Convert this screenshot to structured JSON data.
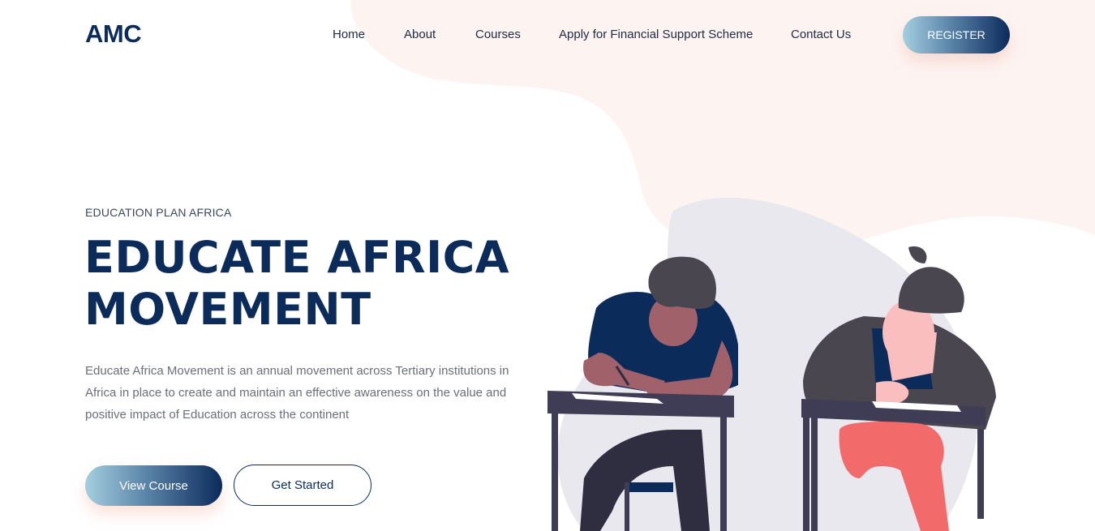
{
  "brand": {
    "logo": "AMC"
  },
  "nav": {
    "items": [
      "Home",
      "About",
      "Courses",
      "Apply for Financial Support Scheme",
      "Contact Us"
    ],
    "register_label": "REGISTER"
  },
  "hero": {
    "eyebrow": "EDUCATION PLAN AFRICA",
    "title_line1": "EDUCATE AFRICA",
    "title_line2": "MOVEMENT",
    "description": "Educate Africa Movement is an annual movement across Tertiary institutions in Africa in place to create and maintain an effective awareness on the value and positive impact of Education across the continent",
    "view_course_label": "View Course",
    "get_started_label": "Get Started"
  },
  "colors": {
    "primary": "#0b2b5b",
    "gradient_start": "#a4cfe0",
    "blob_pink": "#fdf4f2",
    "circle_grey": "#e8e8ee",
    "desk": "#3f3d56",
    "skin_dark": "#a0616a",
    "skin_light": "#fbbebe",
    "pants_red": "#f26a6a"
  },
  "illustration": {
    "icon": "students-writing-exam-illustration"
  }
}
